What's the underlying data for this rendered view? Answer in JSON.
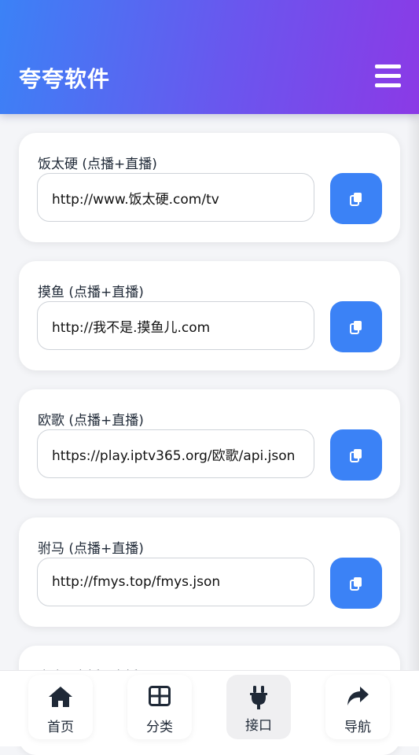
{
  "header": {
    "title": "夸夸软件",
    "menu_icon": "hamburger-menu-icon",
    "gradient_colors": [
      "#3b82f6",
      "#8b3ae6"
    ]
  },
  "accent_color": "#3b82f6",
  "cards": [
    {
      "title": "饭太硬 (点播+直播)",
      "url": "http://www.饭太硬.com/tv"
    },
    {
      "title": "摸鱼 (点播+直播)",
      "url": "http://我不是.摸鱼儿.com"
    },
    {
      "title": "欧歌 (点播+直播)",
      "url": "https://play.iptv365.org/欧歌/api.json"
    },
    {
      "title": "驸马 (点播+直播)",
      "url": "http://fmys.top/fmys.json"
    },
    {
      "title": "春春 (点播+直播)",
      "url": ""
    }
  ],
  "copy_icon": "copy-icon",
  "bottom_nav": [
    {
      "label": "首页",
      "icon": "home-icon"
    },
    {
      "label": "分类",
      "icon": "grid-icon"
    },
    {
      "label": "接口",
      "icon": "plug-icon",
      "active": true
    },
    {
      "label": "导航",
      "icon": "share-icon"
    }
  ]
}
